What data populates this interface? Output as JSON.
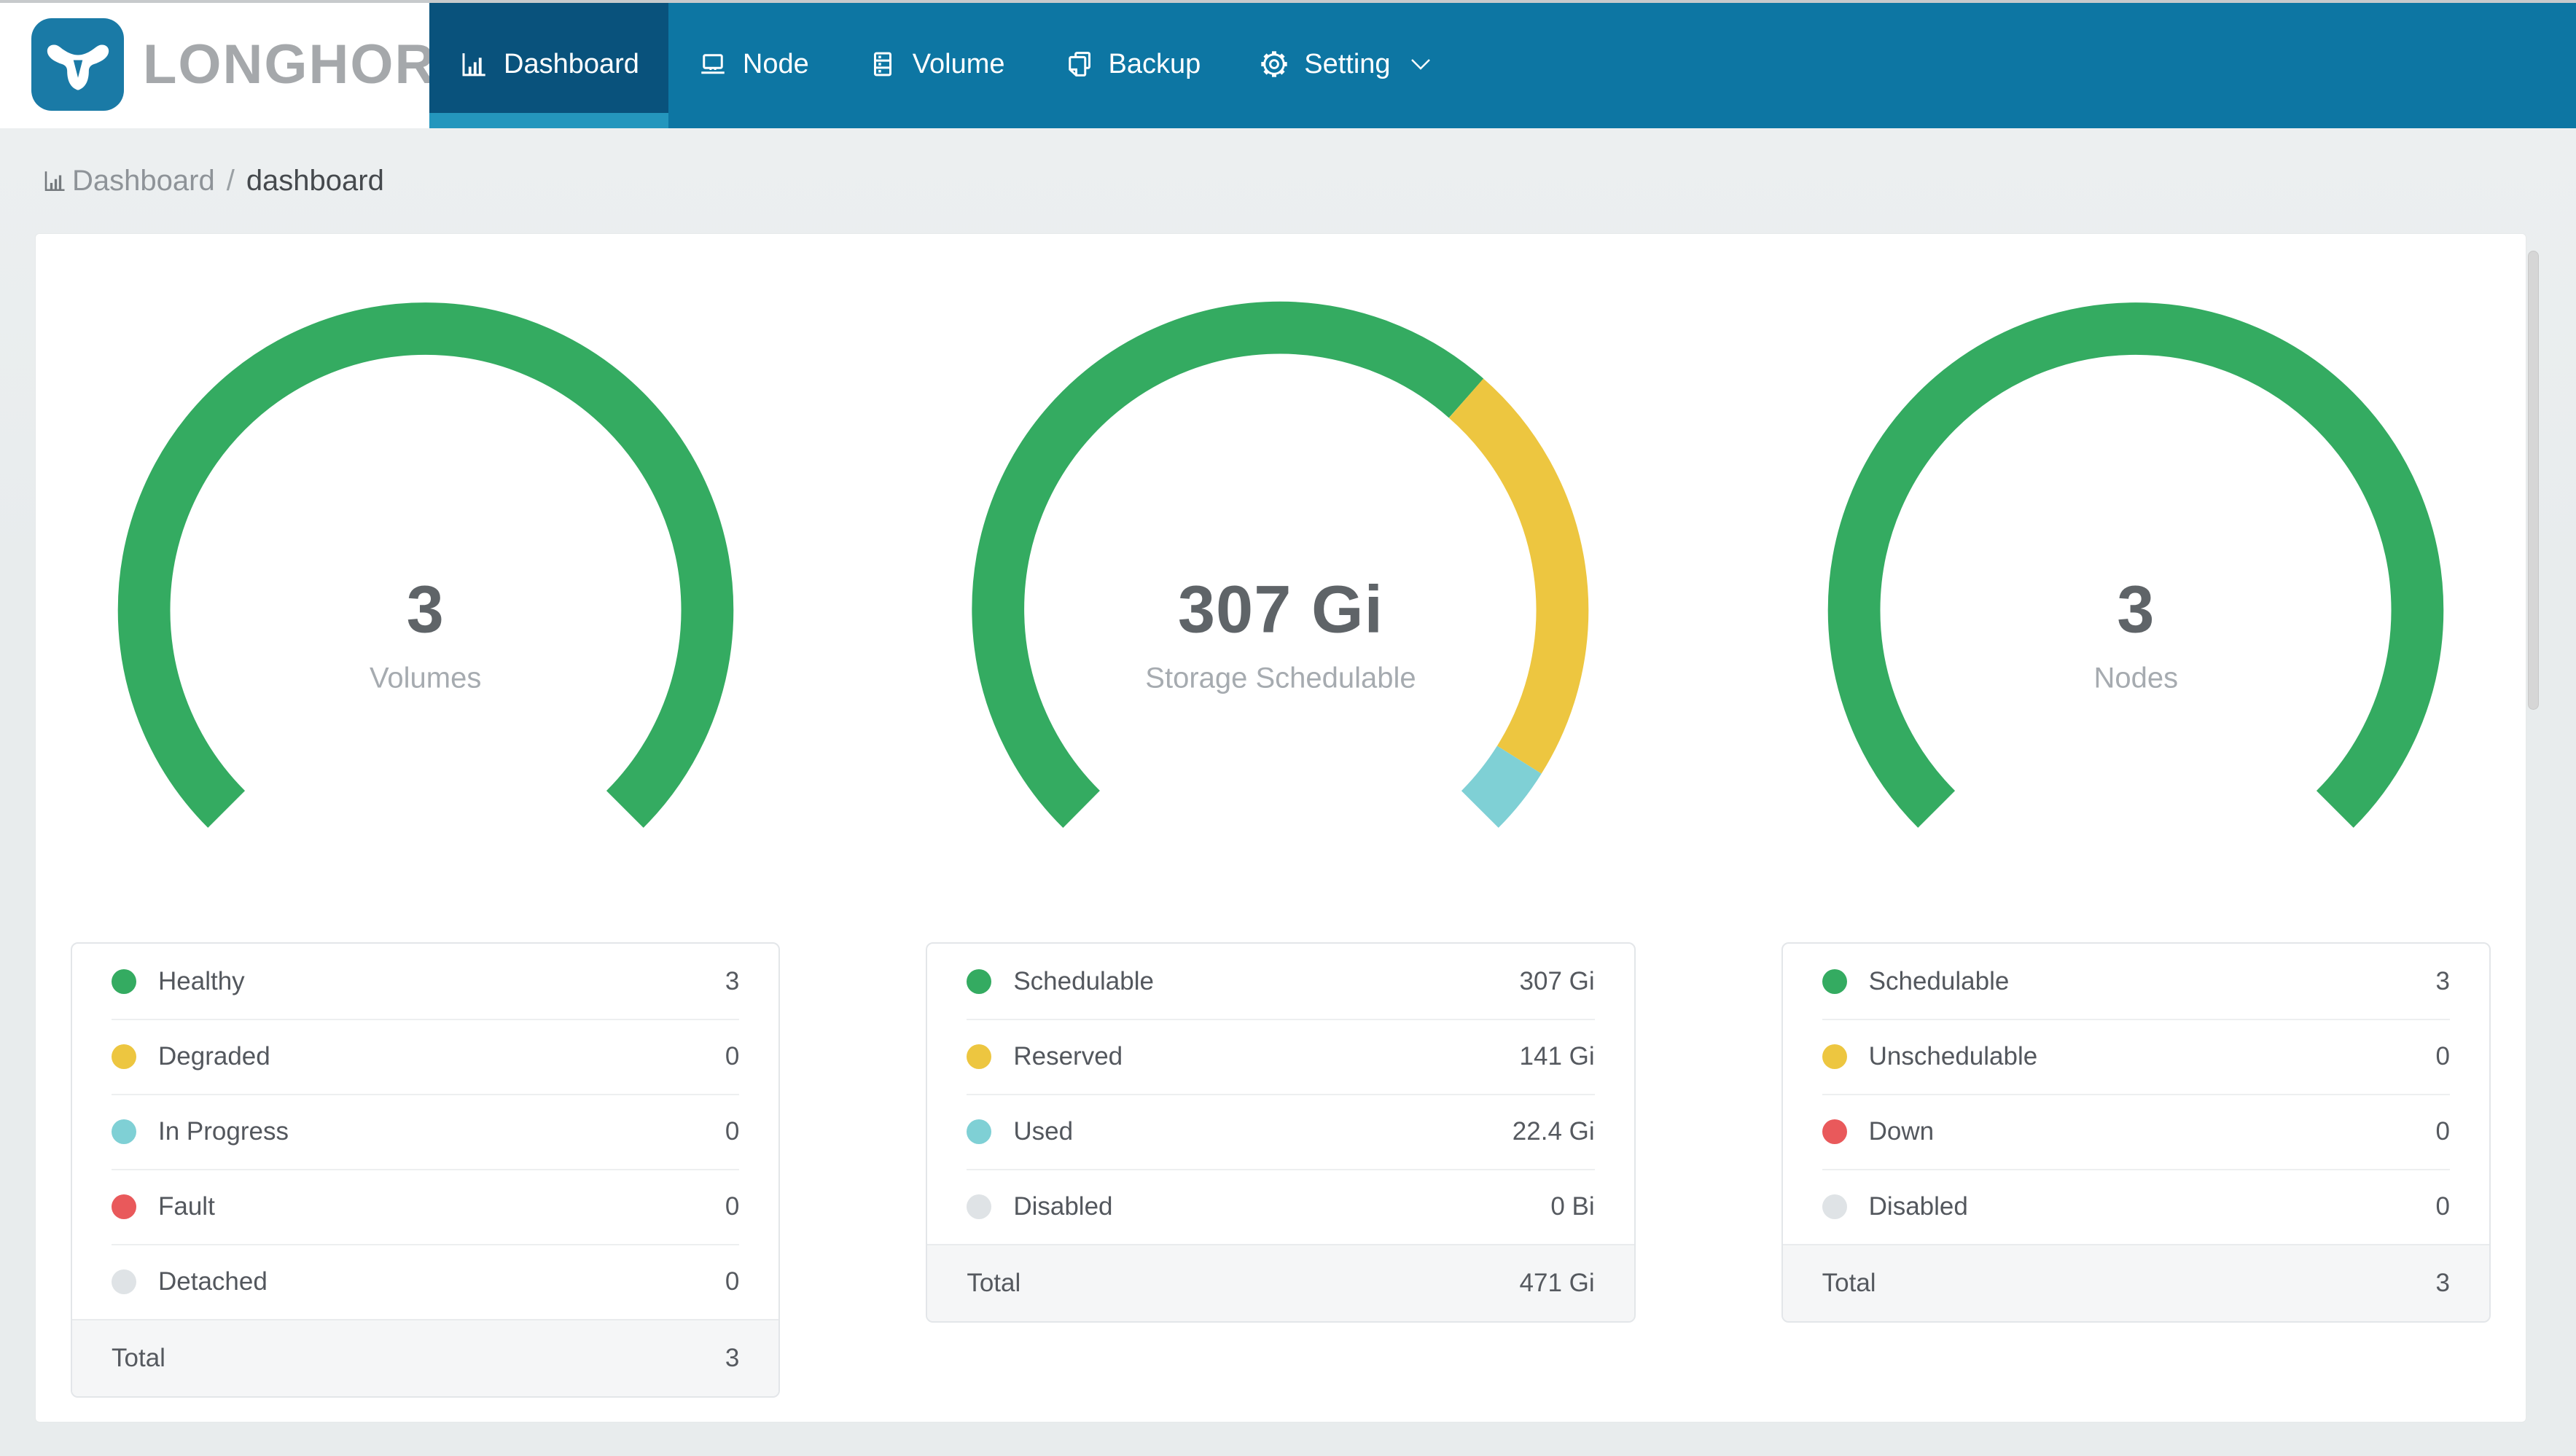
{
  "nav": {
    "brand": "LONGHORN",
    "items": [
      {
        "label": "Dashboard",
        "icon": "bar-chart-icon",
        "active": true
      },
      {
        "label": "Node",
        "icon": "laptop-icon",
        "active": false
      },
      {
        "label": "Volume",
        "icon": "database-icon",
        "active": false
      },
      {
        "label": "Backup",
        "icon": "copy-icon",
        "active": false
      },
      {
        "label": "Setting",
        "icon": "gear-icon",
        "active": false,
        "has_dropdown": true
      }
    ]
  },
  "breadcrumb": {
    "root": "Dashboard",
    "separator": "/",
    "current": "dashboard"
  },
  "colors": {
    "green": "#34ab61",
    "yellow": "#edc640",
    "teal": "#7fd0d5",
    "red": "#e9595b",
    "gray_dot": "#dfe3e6",
    "navbar": "#0d76a3",
    "navbar_active": "#09527c",
    "active_underline": "#2496bd",
    "brand_blue": "#1a7aa6"
  },
  "chart_data": [
    {
      "type": "pie",
      "variant": "gauge-donut",
      "title": "Volumes",
      "center_value": "3",
      "arc_span_deg": 270,
      "segments": [
        {
          "label": "Healthy",
          "value": 3,
          "color": "#34ab61"
        },
        {
          "label": "Degraded",
          "value": 0,
          "color": "#edc640"
        },
        {
          "label": "In Progress",
          "value": 0,
          "color": "#7fd0d5"
        },
        {
          "label": "Fault",
          "value": 0,
          "color": "#e9595b"
        },
        {
          "label": "Detached",
          "value": 0,
          "color": "#dfe3e6"
        }
      ],
      "total": 3
    },
    {
      "type": "pie",
      "variant": "gauge-donut",
      "title": "Storage Schedulable",
      "center_value": "307 Gi",
      "arc_span_deg": 270,
      "segments": [
        {
          "label": "Schedulable",
          "value_gi": 307,
          "color": "#34ab61"
        },
        {
          "label": "Reserved",
          "value_gi": 141,
          "color": "#edc640"
        },
        {
          "label": "Used",
          "value_gi": 22.4,
          "color": "#7fd0d5"
        },
        {
          "label": "Disabled",
          "value_gi": 0,
          "color": "#dfe3e6"
        }
      ],
      "total": "471 Gi"
    },
    {
      "type": "pie",
      "variant": "gauge-donut",
      "title": "Nodes",
      "center_value": "3",
      "arc_span_deg": 270,
      "segments": [
        {
          "label": "Schedulable",
          "value": 3,
          "color": "#34ab61"
        },
        {
          "label": "Unschedulable",
          "value": 0,
          "color": "#edc640"
        },
        {
          "label": "Down",
          "value": 0,
          "color": "#e9595b"
        },
        {
          "label": "Disabled",
          "value": 0,
          "color": "#dfe3e6"
        }
      ],
      "total": 3
    }
  ],
  "panels": [
    {
      "gauge": {
        "value": "3",
        "label": "Volumes"
      },
      "legend": {
        "rows": [
          {
            "label": "Healthy",
            "value": "3",
            "color": "#34ab61"
          },
          {
            "label": "Degraded",
            "value": "0",
            "color": "#edc640"
          },
          {
            "label": "In Progress",
            "value": "0",
            "color": "#7fd0d5"
          },
          {
            "label": "Fault",
            "value": "0",
            "color": "#e9595b"
          },
          {
            "label": "Detached",
            "value": "0",
            "color": "#dfe3e6"
          }
        ],
        "total_label": "Total",
        "total_value": "3"
      }
    },
    {
      "gauge": {
        "value": "307 Gi",
        "label": "Storage Schedulable"
      },
      "legend": {
        "rows": [
          {
            "label": "Schedulable",
            "value": "307 Gi",
            "color": "#34ab61"
          },
          {
            "label": "Reserved",
            "value": "141 Gi",
            "color": "#edc640"
          },
          {
            "label": "Used",
            "value": "22.4 Gi",
            "color": "#7fd0d5"
          },
          {
            "label": "Disabled",
            "value": "0 Bi",
            "color": "#dfe3e6"
          }
        ],
        "total_label": "Total",
        "total_value": "471 Gi"
      }
    },
    {
      "gauge": {
        "value": "3",
        "label": "Nodes"
      },
      "legend": {
        "rows": [
          {
            "label": "Schedulable",
            "value": "3",
            "color": "#34ab61"
          },
          {
            "label": "Unschedulable",
            "value": "0",
            "color": "#edc640"
          },
          {
            "label": "Down",
            "value": "0",
            "color": "#e9595b"
          },
          {
            "label": "Disabled",
            "value": "0",
            "color": "#dfe3e6"
          }
        ],
        "total_label": "Total",
        "total_value": "3"
      }
    }
  ]
}
